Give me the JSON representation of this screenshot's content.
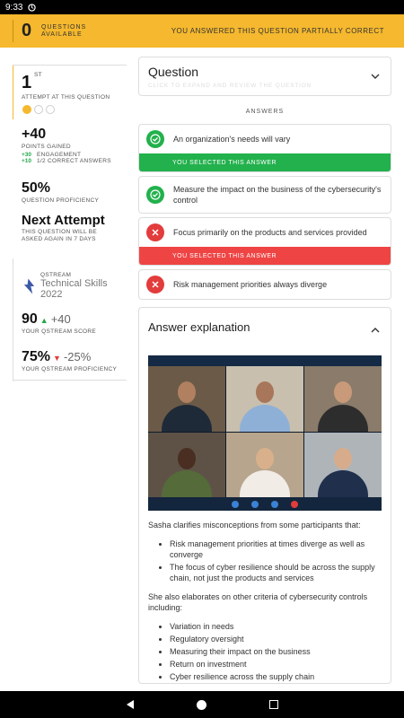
{
  "status_bar": {
    "time": "9:33"
  },
  "top_bar": {
    "questions_available_count": "0",
    "questions_available_label_1": "QUESTIONS",
    "questions_available_label_2": "AVAILABLE",
    "result_message": "YOU ANSWERED THIS QUESTION PARTIALLY CORRECT",
    "accent_color": "#f5b82e"
  },
  "left_panel": {
    "attempt_number": "1",
    "attempt_suffix": "ST",
    "attempt_label": "ATTEMPT AT THIS QUESTION",
    "attempt_dots": {
      "filled": 1,
      "total": 3
    },
    "points_gained": "+40",
    "points_label": "POINTS GAINED",
    "engagement_points": "+30",
    "engagement_label": "ENGAGEMENT",
    "correct_points": "+10",
    "correct_label": "1/2 CORRECT ANSWERS",
    "proficiency_value": "50%",
    "proficiency_label": "QUESTION PROFICIENCY",
    "next_attempt_title": "Next Attempt",
    "next_attempt_line1": "THIS QUESTION WILL BE",
    "next_attempt_line2": "ASKED AGAIN IN 7 DAYS",
    "qstream_label": "QSTREAM",
    "qstream_title": "Technical Skills 2022",
    "score_value": "90",
    "score_delta": "+40",
    "score_label": "YOUR QSTREAM SCORE",
    "qproficiency_value": "75%",
    "qproficiency_delta": "-25%",
    "qproficiency_label": "YOUR QSTREAM PROFICIENCY"
  },
  "question_card": {
    "title": "Question",
    "subtitle": "CLICK TO EXPAND AND REVIEW THE QUESTION"
  },
  "answers_label": "ANSWERS",
  "answers": [
    {
      "text": "An organization's needs will vary",
      "status": "correct",
      "selected_label": "YOU SELECTED THIS ANSWER"
    },
    {
      "text": "Measure the impact on the business of the cybersecurity's control",
      "status": "correct",
      "selected_label": ""
    },
    {
      "text": "Focus primarily on the products and services provided",
      "status": "incorrect",
      "selected_label": "YOU SELECTED THIS ANSWER"
    },
    {
      "text": "Risk management priorities always diverge",
      "status": "incorrect",
      "selected_label": ""
    }
  ],
  "explanation": {
    "title": "Answer explanation",
    "para1": "Sasha clarifies misconceptions from some participants that:",
    "list1": [
      "Risk management priorities at times diverge as well as converge",
      "The focus of cyber resilience should be across the supply chain, not just the products and services"
    ],
    "para2": "She also elaborates on other criteria of cybersecurity controls including:",
    "list2": [
      "Variation in needs",
      "Regulatory oversight",
      "Measuring their impact on the business",
      "Return on investment",
      "Cyber resilience across the supply chain"
    ]
  },
  "colors": {
    "correct": "#22b14c",
    "incorrect": "#e23c3c"
  }
}
